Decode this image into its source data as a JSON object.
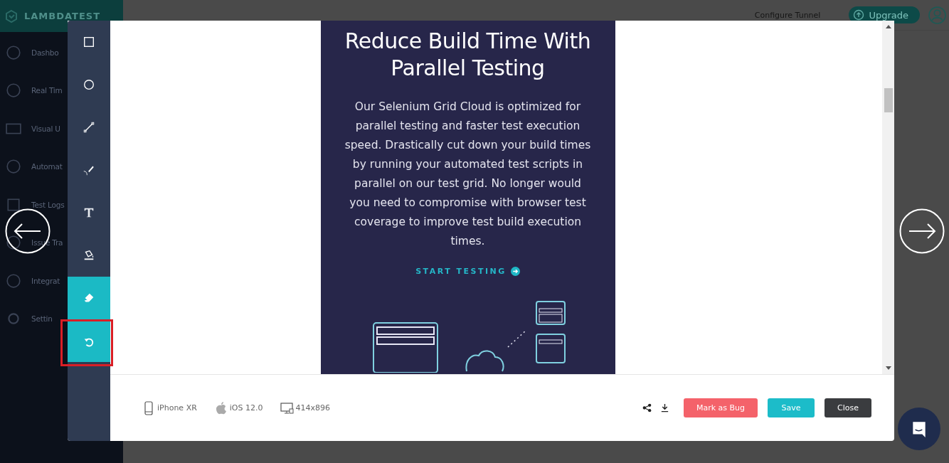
{
  "app": {
    "logo": "LAMBDATEST",
    "header": {
      "tunnel_link": "Configure Tunnel",
      "upgrade_button": "Upgrade"
    },
    "sidebar": {
      "items": [
        {
          "label": "Dashbo"
        },
        {
          "label": "Real Tim"
        },
        {
          "label": "Visual U"
        },
        {
          "label": "Automat"
        },
        {
          "label": "Test Logs"
        },
        {
          "label": "Issue Tra"
        },
        {
          "label": "Integrat"
        },
        {
          "label": "Settin"
        }
      ]
    }
  },
  "editor": {
    "tools": [
      {
        "kind": "rectangle",
        "selected": false,
        "highlighted": false
      },
      {
        "kind": "circle",
        "selected": false,
        "highlighted": false
      },
      {
        "kind": "line",
        "selected": false,
        "highlighted": false
      },
      {
        "kind": "pen",
        "selected": false,
        "highlighted": false
      },
      {
        "kind": "text",
        "selected": false,
        "highlighted": false
      },
      {
        "kind": "fill",
        "selected": false,
        "highlighted": false
      },
      {
        "kind": "eraser",
        "selected": true,
        "highlighted": false
      },
      {
        "kind": "undo",
        "selected": true,
        "highlighted": true
      }
    ],
    "screenshot": {
      "heading": "Reduce Build Time With Parallel Testing",
      "body": "Our Selenium Grid Cloud is optimized for parallel testing and faster test execution speed. Drastically cut down your build times by running your automated test scripts in parallel on our test grid. No longer would you need to compromise with browser test coverage to improve test build execution times.",
      "cta": "START TESTING"
    },
    "device_info": [
      {
        "kind": "device",
        "text": "iPhone XR"
      },
      {
        "kind": "os",
        "text": "iOS 12.0"
      },
      {
        "kind": "resolution",
        "text": "414x896"
      }
    ],
    "buttons": [
      {
        "kind": "bug",
        "label": "Mark as Bug"
      },
      {
        "kind": "save",
        "label": "Save"
      },
      {
        "kind": "close",
        "label": "Close"
      }
    ]
  }
}
